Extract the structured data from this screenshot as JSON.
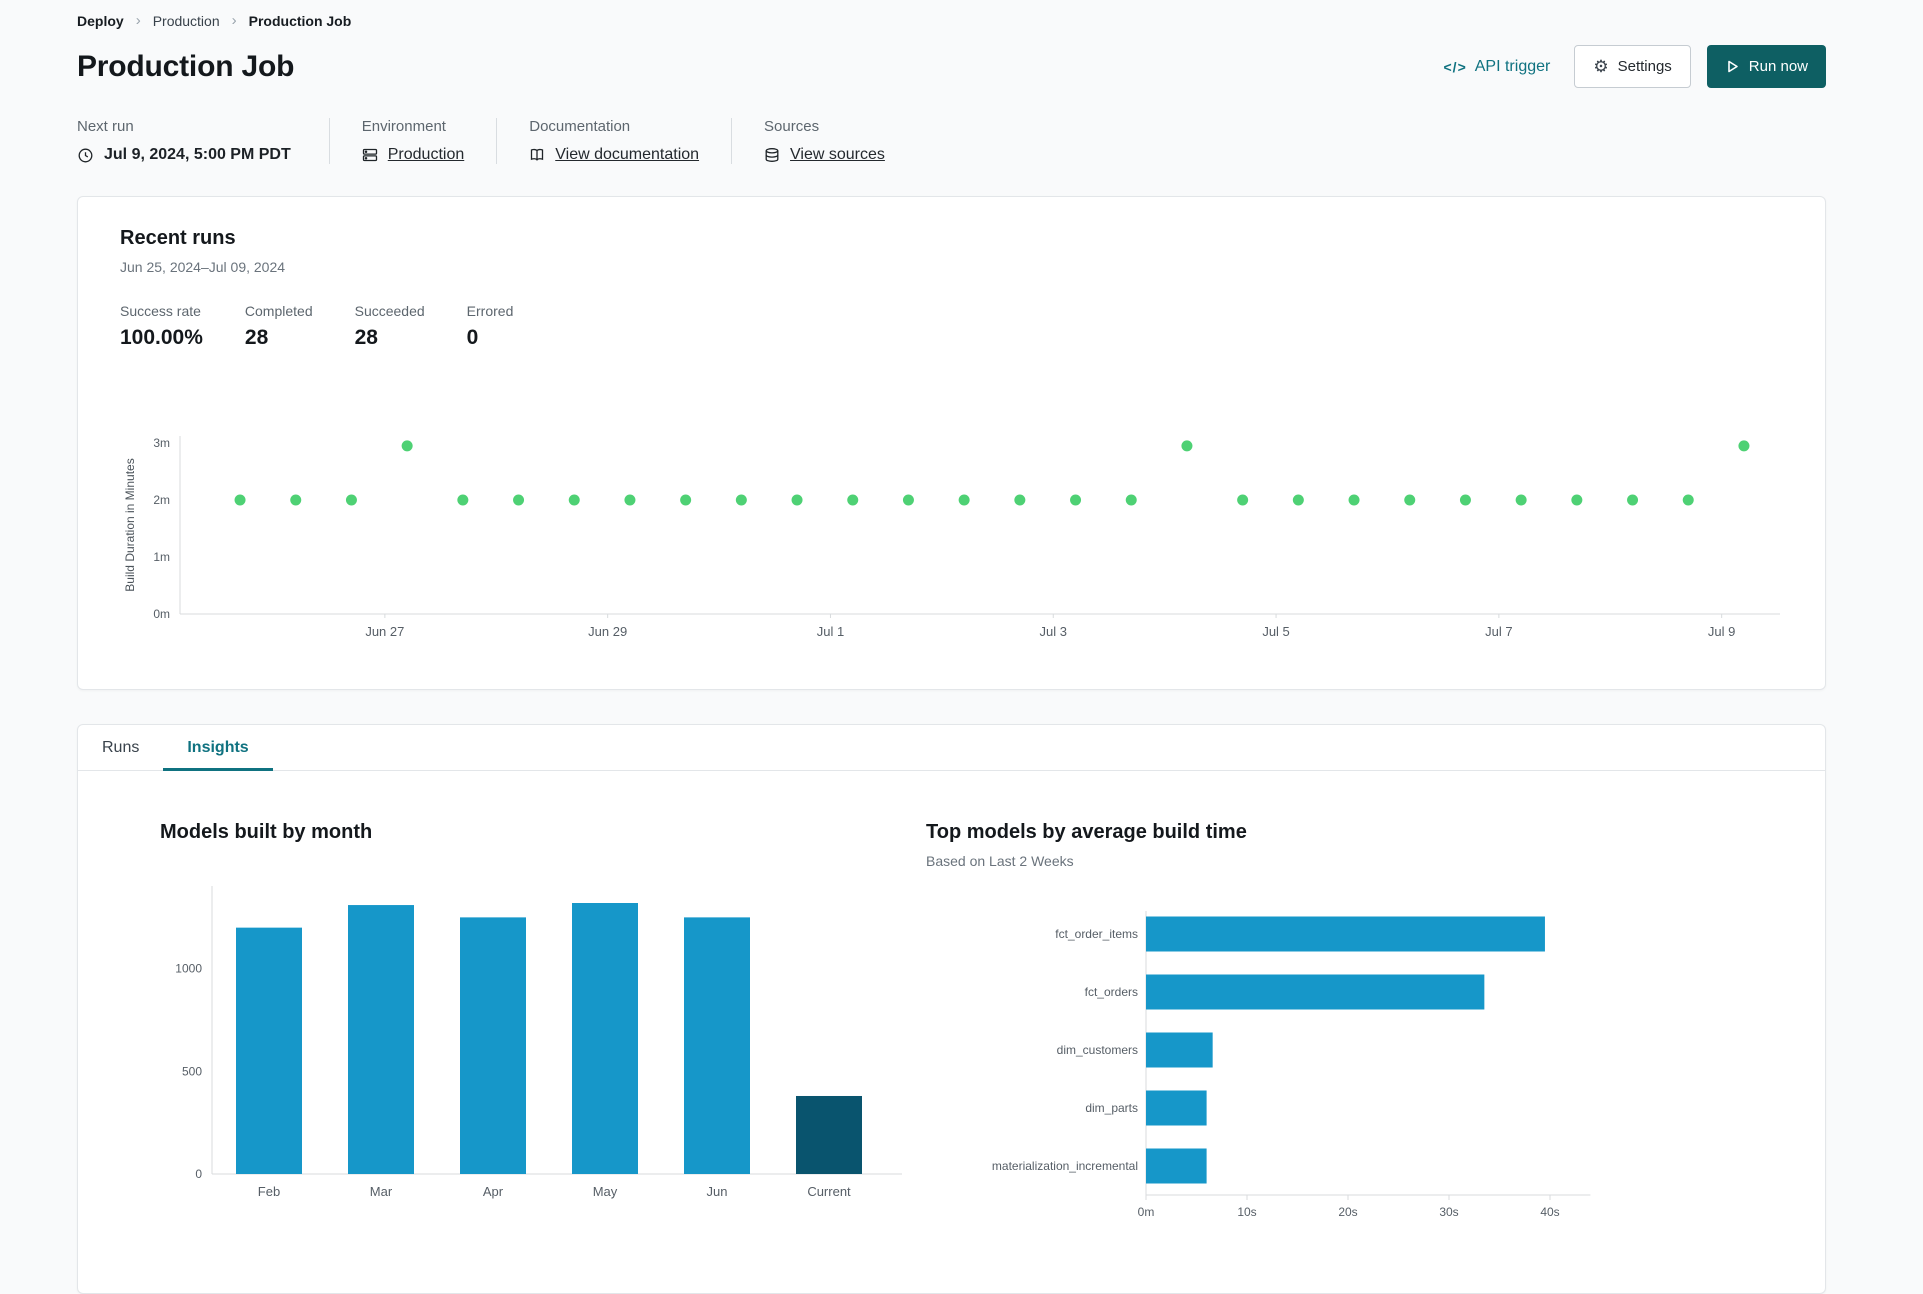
{
  "colors": {
    "accent_teal": "#0f7280",
    "button_teal": "#0e5f63",
    "success_green": "#4ed174",
    "bar_blue": "#1697c9",
    "bar_navy": "#09546e"
  },
  "icons": {
    "chevron": "›",
    "code": "</>",
    "gear": "⚙"
  },
  "breadcrumb": {
    "items": [
      "Deploy",
      "Production",
      "Production Job"
    ]
  },
  "header": {
    "title": "Production Job",
    "api_trigger": "API trigger",
    "settings": "Settings",
    "run_now": "Run now"
  },
  "meta": [
    {
      "label": "Next run",
      "value": "Jul 9, 2024, 5:00 PM PDT"
    },
    {
      "label": "Environment",
      "value": "Production"
    },
    {
      "label": "Documentation",
      "value": "View documentation"
    },
    {
      "label": "Sources",
      "value": "View sources"
    }
  ],
  "recent_runs": {
    "title": "Recent runs",
    "date_range": "Jun 25, 2024–Jul 09, 2024",
    "stats": [
      {
        "label": "Success rate",
        "value": "100.00%"
      },
      {
        "label": "Completed",
        "value": "28"
      },
      {
        "label": "Succeeded",
        "value": "28"
      },
      {
        "label": "Errored",
        "value": "0"
      }
    ]
  },
  "tabs": [
    {
      "label": "Runs",
      "active": false
    },
    {
      "label": "Insights",
      "active": true
    }
  ],
  "chart_data": [
    {
      "id": "run_durations",
      "type": "scatter",
      "ylabel": "Build Duration in Minutes",
      "point_color": "#4ed174",
      "ylim": [
        0,
        3.2
      ],
      "y_ticks": [
        {
          "value": 0,
          "label": "0m"
        },
        {
          "value": 1,
          "label": "1m"
        },
        {
          "value": 2,
          "label": "2m"
        },
        {
          "value": 3,
          "label": "3m"
        }
      ],
      "x_ticks": [
        {
          "day": 2,
          "label": "Jun 27"
        },
        {
          "day": 4,
          "label": "Jun 29"
        },
        {
          "day": 6,
          "label": "Jul 1"
        },
        {
          "day": 8,
          "label": "Jul 3"
        },
        {
          "day": 10,
          "label": "Jul 5"
        },
        {
          "day": 12,
          "label": "Jul 7"
        },
        {
          "day": 14,
          "label": "Jul 9"
        }
      ],
      "points": [
        {
          "day": 0.7,
          "minutes": 2.0
        },
        {
          "day": 1.2,
          "minutes": 2.0
        },
        {
          "day": 1.7,
          "minutes": 2.0
        },
        {
          "day": 2.2,
          "minutes": 2.95
        },
        {
          "day": 2.7,
          "minutes": 2.0
        },
        {
          "day": 3.2,
          "minutes": 2.0
        },
        {
          "day": 3.7,
          "minutes": 2.0
        },
        {
          "day": 4.2,
          "minutes": 2.0
        },
        {
          "day": 4.7,
          "minutes": 2.0
        },
        {
          "day": 5.2,
          "minutes": 2.0
        },
        {
          "day": 5.7,
          "minutes": 2.0
        },
        {
          "day": 6.2,
          "minutes": 2.0
        },
        {
          "day": 6.7,
          "minutes": 2.0
        },
        {
          "day": 7.2,
          "minutes": 2.0
        },
        {
          "day": 7.7,
          "minutes": 2.0
        },
        {
          "day": 8.2,
          "minutes": 2.0
        },
        {
          "day": 8.7,
          "minutes": 2.0
        },
        {
          "day": 9.2,
          "minutes": 2.95
        },
        {
          "day": 9.7,
          "minutes": 2.0
        },
        {
          "day": 10.2,
          "minutes": 2.0
        },
        {
          "day": 10.7,
          "minutes": 2.0
        },
        {
          "day": 11.2,
          "minutes": 2.0
        },
        {
          "day": 11.7,
          "minutes": 2.0
        },
        {
          "day": 12.2,
          "minutes": 2.0
        },
        {
          "day": 12.7,
          "minutes": 2.0
        },
        {
          "day": 13.2,
          "minutes": 2.0
        },
        {
          "day": 13.7,
          "minutes": 2.0
        },
        {
          "day": 14.2,
          "minutes": 2.95
        }
      ]
    },
    {
      "id": "models_by_month",
      "type": "bar",
      "title": "Models built by month",
      "categories": [
        "Feb",
        "Mar",
        "Apr",
        "May",
        "Jun",
        "Current"
      ],
      "values": [
        1200,
        1310,
        1250,
        1320,
        1250,
        380
      ],
      "colors": [
        "#1697c9",
        "#1697c9",
        "#1697c9",
        "#1697c9",
        "#1697c9",
        "#09546e"
      ],
      "y_ticks": [
        0,
        500,
        1000
      ],
      "ylim": [
        0,
        1420
      ]
    },
    {
      "id": "top_models_by_build_time",
      "type": "hbar",
      "title": "Top models by average build time",
      "subtitle": "Based on Last 2 Weeks",
      "categories": [
        "fct_order_items",
        "fct_orders",
        "dim_customers",
        "dim_parts",
        "materialization_incremental"
      ],
      "values_seconds": [
        39.5,
        33.5,
        6.6,
        6.0,
        6.0
      ],
      "bar_color": "#1697c9",
      "xlim": [
        0,
        44
      ],
      "x_ticks": [
        {
          "value": 0,
          "label": "0m"
        },
        {
          "value": 10,
          "label": "10s"
        },
        {
          "value": 20,
          "label": "20s"
        },
        {
          "value": 30,
          "label": "30s"
        },
        {
          "value": 40,
          "label": "40s"
        }
      ]
    }
  ]
}
